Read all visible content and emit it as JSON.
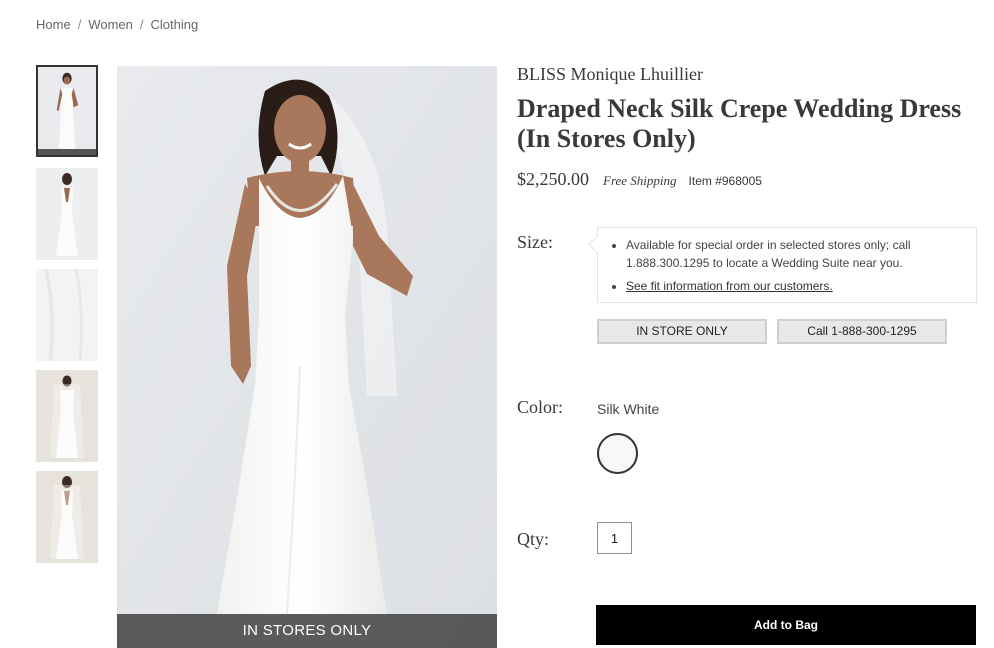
{
  "breadcrumb": {
    "items": [
      "Home",
      "Women",
      "Clothing"
    ],
    "separator": "/"
  },
  "gallery": {
    "thumbnails": [
      {
        "alt": "front view",
        "active": true
      },
      {
        "alt": "back view",
        "active": false
      },
      {
        "alt": "fabric detail",
        "active": false
      },
      {
        "alt": "front view with veil",
        "active": false
      },
      {
        "alt": "back view with veil",
        "active": false
      }
    ],
    "main_banner": "IN STORES ONLY"
  },
  "product": {
    "brand": "BLISS Monique Lhuillier",
    "title": "Draped Neck Silk Crepe Wedding Dress (In Stores Only)",
    "price": "$2,250.00",
    "shipping": "Free Shipping",
    "item_number": "Item #968005"
  },
  "size": {
    "label": "Size:",
    "notice": "Available for special order in selected stores only; call 1.888.300.1295 to locate a Wedding Suite near you.",
    "fit_link": "See fit information from our customers.",
    "in_store_button": "IN STORE ONLY",
    "call_button": "Call 1-888-300-1295"
  },
  "color": {
    "label": "Color:",
    "selected": "Silk White",
    "swatch_hex": "#f7f7f5"
  },
  "quantity": {
    "label": "Qty:",
    "value": "1"
  },
  "cart": {
    "add_label": "Add to Bag"
  },
  "colors": {
    "button_bg": "#000000",
    "banner_bg": "#464646",
    "text": "#393939"
  }
}
